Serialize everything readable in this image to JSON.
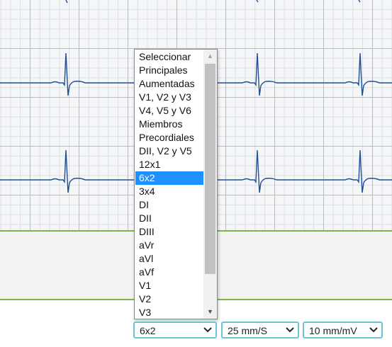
{
  "dropdown_list": {
    "options": [
      "Seleccionar",
      "Principales",
      "Aumentadas",
      "V1, V2 y V3",
      "V4, V5 y V6",
      "Miembros",
      "Precordiales",
      "DII, V2 y V5",
      "12x1",
      "6x2",
      "3x4",
      "DI",
      "DII",
      "DIII",
      "aVr",
      "aVl",
      "aVf",
      "V1",
      "V2",
      "V3"
    ],
    "selected_index": 9
  },
  "controls": {
    "lead_layout": "6x2",
    "paper_speed": "25 mm/S",
    "amplitude": "10 mm/mV"
  },
  "icons": {
    "scroll_up": "triangle-up-icon",
    "scroll_down": "triangle-down-icon",
    "select_arrow": "chevron-down-icon"
  },
  "colors": {
    "trace": "#1f4e96",
    "accent_green": "#7ab648",
    "select_border": "#6cc3d5",
    "selected_option": "#1e90ff",
    "grid_major": "#b9bdc2",
    "grid_minor": "#dcdfe3"
  }
}
